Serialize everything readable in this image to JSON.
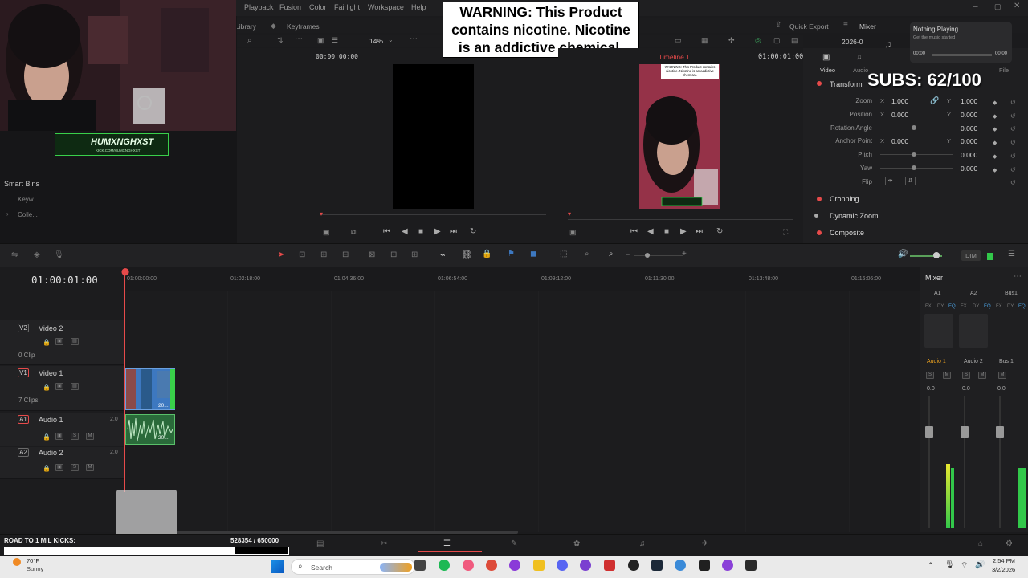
{
  "menu": {
    "items": [
      "Playback",
      "Fusion",
      "Color",
      "Fairlight",
      "Workspace",
      "Help"
    ]
  },
  "toolbar": {
    "library": "Library",
    "keyframes": "Keyframes",
    "zoom": "14%",
    "quick_export": "Quick Export",
    "mixer": "Mixer",
    "date": "2026-0"
  },
  "warning": {
    "text": "WARNING: This Product contains nicotine. Nicotine is an addictive chemical."
  },
  "viewer": {
    "source_tc": "00:00:00:00",
    "timeline_name": "Timeline 1",
    "timeline_tc": "01:00:01:00",
    "mini_warning": "WARNING: This Product contains nicotine. Nicotine is an addictive chemical."
  },
  "webcam": {
    "name": "HUMXNGHXST",
    "kick": "KICK.COM/HUMXNGHXST"
  },
  "smart_bins": {
    "title": "Smart Bins",
    "items": [
      "Keyw...",
      "Colle..."
    ]
  },
  "now_playing": {
    "title": "Nothing Playing",
    "subtitle": "Get the music started",
    "t0": "00:00",
    "t1": "00:00"
  },
  "subs": {
    "text": "SUBS: 62/100"
  },
  "inspector": {
    "tabs": [
      "Video",
      "Audio",
      "File"
    ],
    "transform": "Transform",
    "rows": [
      {
        "label": "Zoom",
        "xl": "X",
        "x": "1.000",
        "yl": "Y",
        "y": "1.000"
      },
      {
        "label": "Position",
        "xl": "X",
        "x": "0.000",
        "yl": "Y",
        "y": "0.000"
      },
      {
        "label": "Rotation Angle",
        "xl": "",
        "x": "",
        "yl": "",
        "y": "0.000"
      },
      {
        "label": "Anchor Point",
        "xl": "X",
        "x": "0.000",
        "yl": "Y",
        "y": "0.000"
      },
      {
        "label": "Pitch",
        "xl": "",
        "x": "",
        "yl": "",
        "y": "0.000"
      },
      {
        "label": "Yaw",
        "xl": "",
        "x": "",
        "yl": "",
        "y": "0.000"
      },
      {
        "label": "Flip",
        "xl": "",
        "x": "",
        "yl": "",
        "y": ""
      }
    ],
    "sections": [
      "Cropping",
      "Dynamic Zoom",
      "Composite"
    ]
  },
  "timeline": {
    "tc": "01:00:01:00",
    "ruler": [
      "01:00:00:00",
      "01:02:18:00",
      "01:04:36:00",
      "01:06:54:00",
      "01:09:12:00",
      "01:11:30:00",
      "01:13:48:00",
      "01:16:06:00"
    ],
    "dim": "DIM",
    "tracks": [
      {
        "id": "V2",
        "name": "Video 2",
        "clips": "0 Clip",
        "num": ""
      },
      {
        "id": "V1",
        "name": "Video 1",
        "clips": "7 Clips",
        "num": ""
      },
      {
        "id": "A1",
        "name": "Audio 1",
        "clips": "",
        "num": "2.0"
      },
      {
        "id": "A2",
        "name": "Audio 2",
        "clips": "",
        "num": "2.0"
      }
    ],
    "clip_label": "20..."
  },
  "mixer": {
    "title": "Mixer",
    "channels": [
      "A1",
      "A2",
      "Bus1"
    ],
    "names": [
      "Audio 1",
      "Audio 2",
      "Bus 1"
    ],
    "values": [
      "0.0",
      "0.0",
      "0.0"
    ],
    "row_labels": [
      "FX",
      "DY",
      "EQ"
    ],
    "sm": [
      "S",
      "M"
    ]
  },
  "goal": {
    "label": "ROAD TO 1 MIL KICKS:",
    "progress": "528354  / 650000",
    "fraction": 0.81
  },
  "taskbar": {
    "temp": "70°F",
    "weather": "Sunny",
    "search": "Search",
    "time": "2:54 PM",
    "date": "3/2/2026"
  },
  "colors": {
    "accent": "#e64a4a",
    "timeline_blue": "#3d78c0",
    "audio_green": "#3aa05a",
    "subs_text": "#ffffff"
  }
}
